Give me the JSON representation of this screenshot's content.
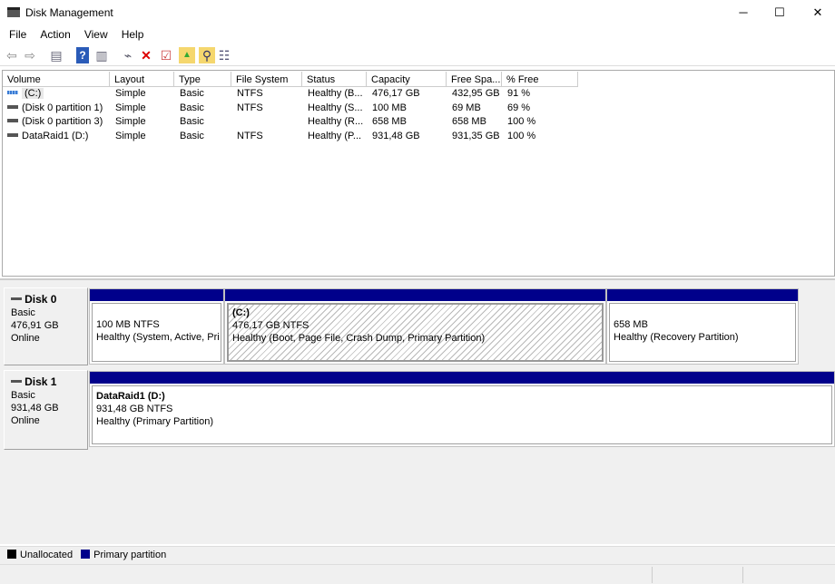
{
  "window": {
    "title": "Disk Management",
    "minimize": "─",
    "maximize": "☐",
    "close": "✕"
  },
  "menu": [
    "File",
    "Action",
    "View",
    "Help"
  ],
  "toolbar": [
    {
      "icon": "back-arrow-icon",
      "glyph": "⇦"
    },
    {
      "icon": "forward-arrow-icon",
      "glyph": "⇨"
    },
    {
      "icon": "show-hide-console-tree-icon",
      "glyph": "▤"
    },
    {
      "icon": "help-icon",
      "glyph": "?"
    },
    {
      "icon": "show-action-pane-icon",
      "glyph": "▥"
    },
    {
      "icon": "connect-drive-icon",
      "glyph": "⌁"
    },
    {
      "icon": "delete-icon",
      "glyph": "✕"
    },
    {
      "icon": "properties-check-icon",
      "glyph": "☑"
    },
    {
      "icon": "folder-up-icon",
      "glyph": "▲"
    },
    {
      "icon": "search-folder-icon",
      "glyph": "⚲"
    },
    {
      "icon": "list-settings-icon",
      "glyph": "☷"
    }
  ],
  "columns": [
    "Volume",
    "Layout",
    "Type",
    "File System",
    "Status",
    "Capacity",
    "Free Spa...",
    "% Free"
  ],
  "rows": [
    {
      "volume": "(C:)",
      "icon": "striped",
      "cells": [
        "Simple",
        "Basic",
        "NTFS",
        "Healthy (B...",
        "476,17 GB",
        "432,95 GB",
        "91 %"
      ]
    },
    {
      "volume": "(Disk 0 partition 1)",
      "cells": [
        "Simple",
        "Basic",
        "NTFS",
        "Healthy (S...",
        "100 MB",
        "69 MB",
        "69 %"
      ]
    },
    {
      "volume": "(Disk 0 partition 3)",
      "cells": [
        "Simple",
        "Basic",
        "",
        "Healthy (R...",
        "658 MB",
        "658 MB",
        "100 %"
      ]
    },
    {
      "volume": "DataRaid1 (D:)",
      "cells": [
        "Simple",
        "Basic",
        "NTFS",
        "Healthy (P...",
        "931,48 GB",
        "931,35 GB",
        "100 %"
      ]
    }
  ],
  "disks": [
    {
      "name": "Disk 0",
      "type": "Basic",
      "size": "476,91 GB",
      "state": "Online",
      "partitions": [
        {
          "title": "",
          "size": "100 MB NTFS",
          "status": "Healthy (System, Active, Pri"
        },
        {
          "title": "(C:)",
          "size": "476,17 GB NTFS",
          "status": "Healthy (Boot, Page File, Crash Dump, Primary Partition)"
        },
        {
          "title": "",
          "size": "658 MB",
          "status": "Healthy (Recovery Partition)"
        }
      ]
    },
    {
      "name": "Disk 1",
      "type": "Basic",
      "size": "931,48 GB",
      "state": "Online",
      "partitions": [
        {
          "title": "DataRaid1  (D:)",
          "size": "931,48 GB NTFS",
          "status": "Healthy (Primary Partition)"
        }
      ]
    }
  ],
  "legend": [
    {
      "label": "Unallocated",
      "color": "#000000"
    },
    {
      "label": "Primary partition",
      "color": "#00008b"
    }
  ]
}
